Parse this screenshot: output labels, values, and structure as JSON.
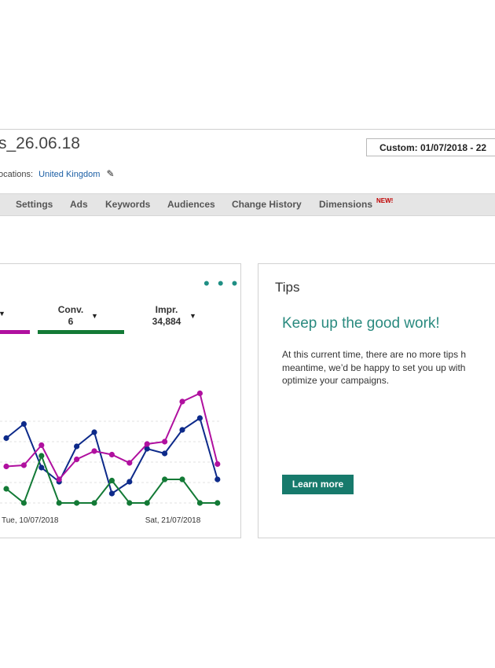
{
  "header": {
    "campaign_title": "s_26.06.18",
    "date_range": "Custom: 01/07/2018 - 22",
    "locations_label": "ocations:",
    "locations_value": "United Kingdom"
  },
  "tabs": [
    {
      "label": "Settings"
    },
    {
      "label": "Ads"
    },
    {
      "label": "Keywords"
    },
    {
      "label": "Audiences"
    },
    {
      "label": "Change History"
    },
    {
      "label": "Dimensions"
    }
  ],
  "new_badge": "NEW!",
  "chart_panel": {
    "more_menu": "• • •",
    "metrics": [
      {
        "label": "Conv.",
        "value": "6"
      },
      {
        "label": "Impr.",
        "value": "34,884"
      }
    ],
    "colors": {
      "magenta": "#b0109f",
      "blue": "#0d2a8a",
      "green": "#137a36",
      "grid": "#e2e2e2"
    }
  },
  "chart_data": {
    "type": "line",
    "x": [
      "",
      "",
      "",
      "",
      "",
      "",
      "",
      "",
      "",
      "",
      "",
      "",
      ""
    ],
    "tick_labels": [
      "Tue, 10/07/2018",
      "Sat, 21/07/2018"
    ],
    "series": [
      {
        "values": [
          55,
          67,
          30,
          18,
          48,
          60,
          8,
          18,
          46,
          42,
          62,
          72,
          20
        ],
        "color": "#0d2a8a"
      },
      {
        "values": [
          31,
          32,
          49,
          20,
          37,
          44,
          41,
          34,
          50,
          52,
          86,
          93,
          33
        ],
        "color": "#b0109f"
      },
      {
        "values": [
          12,
          0,
          40,
          0,
          0,
          0,
          19,
          0,
          0,
          20,
          20,
          0,
          0
        ],
        "color": "#137a36"
      }
    ]
  },
  "tips": {
    "title": "Tips",
    "heading": "Keep up the good work!",
    "body_lines": [
      "At this current time, there are no more tips h",
      "meantime, we’d be happy to set you up with",
      "optimize your campaigns."
    ],
    "button_label": "Learn more"
  }
}
